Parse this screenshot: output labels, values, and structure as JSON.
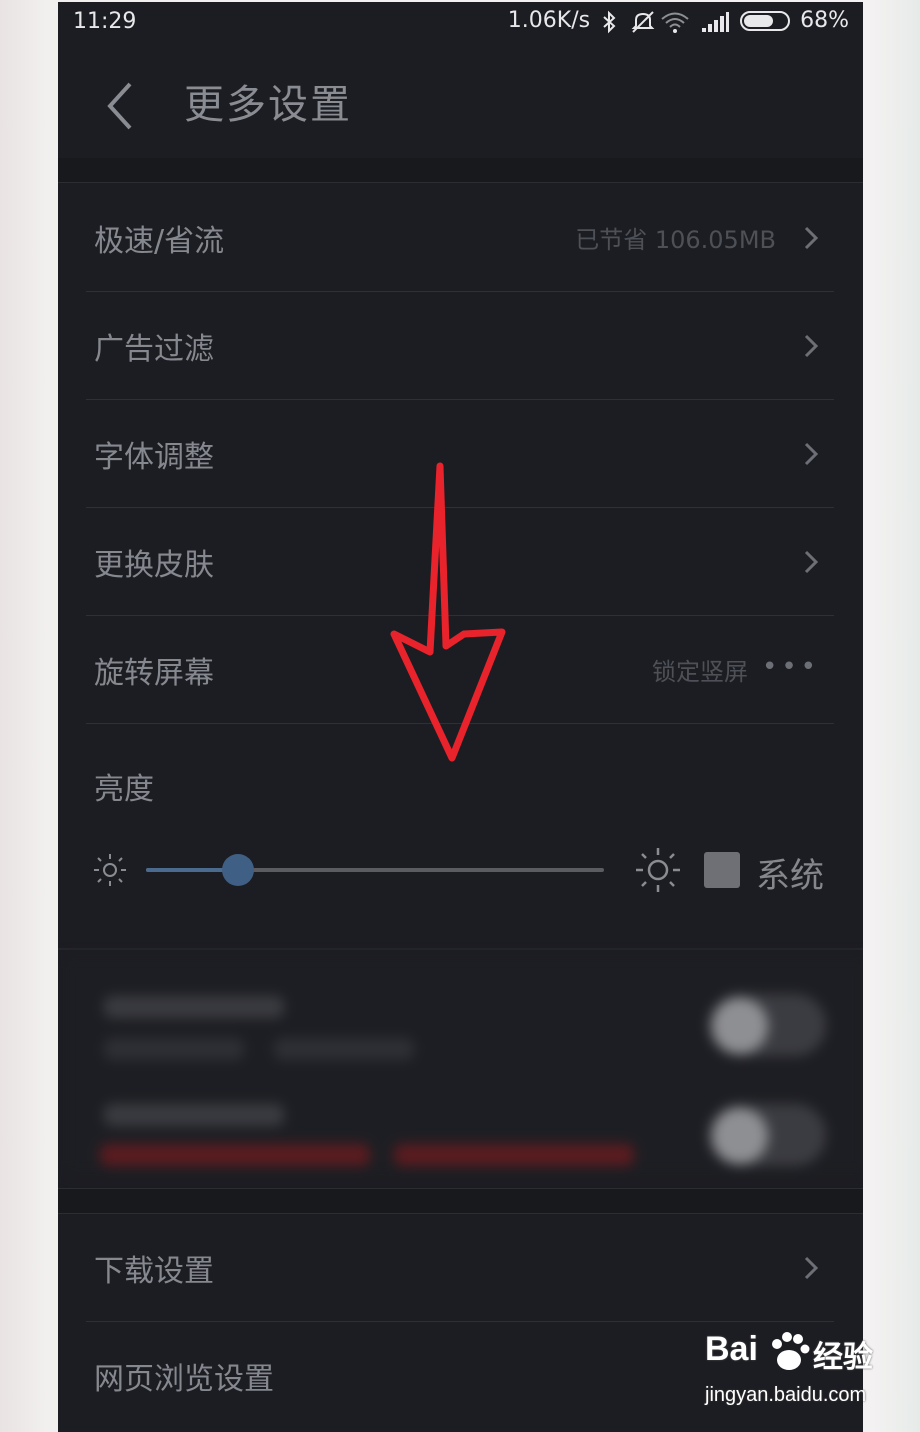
{
  "status_bar": {
    "time": "11:29",
    "speed": "1.06K/s",
    "battery": "68%",
    "battery_level": 0.68,
    "icons": [
      "bluetooth-icon",
      "mute-icon",
      "wifi-icon",
      "signal-icon",
      "battery-icon"
    ]
  },
  "header": {
    "title": "更多设置",
    "back_icon": "chevron-left-icon"
  },
  "settings": [
    {
      "label": "极速/省流",
      "value": "已节省 106.05MB",
      "trailing": "chevron"
    },
    {
      "label": "广告过滤",
      "value": "",
      "trailing": "chevron"
    },
    {
      "label": "字体调整",
      "value": "",
      "trailing": "chevron"
    },
    {
      "label": "更换皮肤",
      "value": "",
      "trailing": "chevron"
    },
    {
      "label": "旋转屏幕",
      "value": "锁定竖屏",
      "trailing": "more"
    }
  ],
  "brightness": {
    "label": "亮度",
    "level": 0.2,
    "system_label": "系统",
    "system_checked": false
  },
  "settings_bottom": [
    {
      "label": "下载设置",
      "trailing": "chevron"
    },
    {
      "label": "网页浏览设置",
      "trailing": "chevron"
    }
  ],
  "watermark": {
    "brand": "Bai 经验",
    "brand_left": "Bai",
    "brand_right": "经验",
    "url": "jingyan.baidu.com"
  },
  "colors": {
    "background": "#1c1d22",
    "label": "#868890",
    "accent": "#3f5f84",
    "arrow": "#e8232b"
  }
}
